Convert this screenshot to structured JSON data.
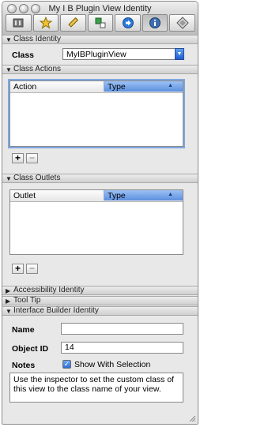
{
  "window": {
    "title": "My I B Plugin View Identity"
  },
  "toolbar": {
    "tabs": [
      {
        "icon": "gear-sliders-icon"
      },
      {
        "icon": "star-icon"
      },
      {
        "icon": "ruler-icon"
      },
      {
        "icon": "connections-icon"
      },
      {
        "icon": "arrow-right-circle-icon"
      },
      {
        "icon": "info-icon",
        "selected": true
      },
      {
        "icon": "plugin-icon"
      }
    ]
  },
  "class_identity": {
    "header": "Class Identity",
    "class_label": "Class",
    "class_value": "MyIBPluginView"
  },
  "class_actions": {
    "header": "Class Actions",
    "columns": [
      "Action",
      "Type"
    ],
    "add_label": "+",
    "remove_label": "−"
  },
  "class_outlets": {
    "header": "Class Outlets",
    "columns": [
      "Outlet",
      "Type"
    ],
    "add_label": "+",
    "remove_label": "−"
  },
  "accessibility": {
    "header": "Accessibility Identity"
  },
  "tooltip": {
    "header": "Tool Tip"
  },
  "ib_identity": {
    "header": "Interface Builder Identity",
    "name_label": "Name",
    "name_value": "",
    "object_id_label": "Object ID",
    "object_id_value": "14",
    "notes_label": "Notes",
    "show_with_selection": "Show With Selection",
    "notes_text": "Use the inspector to set the custom class of this view to the class name of your view."
  },
  "colors": {
    "accent": "#5c8fdf",
    "select_arrow": "#1f5ed6"
  }
}
